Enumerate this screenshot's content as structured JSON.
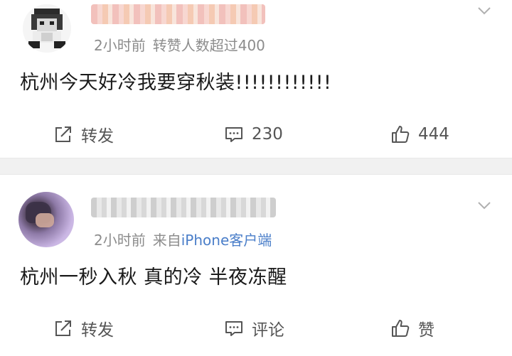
{
  "posts": [
    {
      "meta": {
        "time": "2小时前",
        "info": "转赞人数超过400"
      },
      "content": "杭州今天好冷我要穿秋装!!!!!!!!!!!!",
      "actions": {
        "repost": "转发",
        "comment": "230",
        "like": "444"
      }
    },
    {
      "meta": {
        "time": "2小时前",
        "source_prefix": "来自",
        "source": "iPhone客户端"
      },
      "content": "杭州一秒入秋 真的冷 半夜冻醒",
      "actions": {
        "repost": "转发",
        "comment": "评论",
        "like": "赞"
      }
    }
  ],
  "colors": {
    "source_link": "#4a7ec9",
    "meta": "#8c8c8c",
    "separator": "#f1f1f1"
  },
  "icons": [
    "chevron-down-icon",
    "repost-icon",
    "comment-icon",
    "like-icon"
  ]
}
